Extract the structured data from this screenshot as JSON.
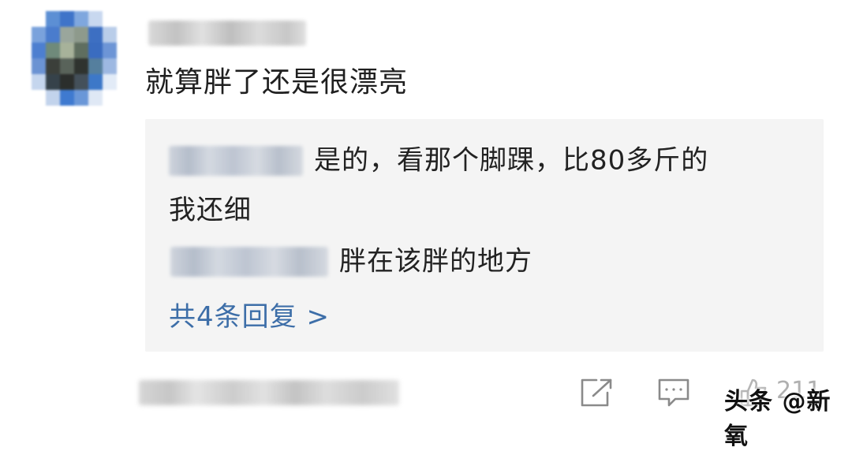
{
  "comment": {
    "text": "就算胖了还是很漂亮"
  },
  "replies": [
    {
      "line1": "是的，看那个脚踝，比80多斤的",
      "line2": "我还细"
    },
    {
      "line1": "胖在该胖的地方"
    }
  ],
  "more_replies_label": "共4条回复 >",
  "actions": {
    "share_icon": "share-icon",
    "comment_icon": "comment-icon",
    "like_icon": "like-icon",
    "like_count": "211"
  },
  "watermark": "头条 @新氧",
  "colors": {
    "link": "#3d6ea8",
    "reply_bg": "#f4f4f4",
    "icon": "#8a8a8a"
  }
}
